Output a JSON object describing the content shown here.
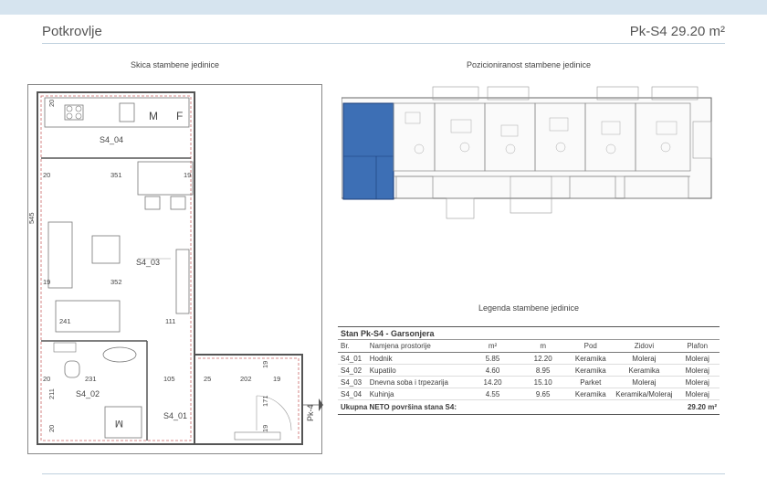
{
  "header": {
    "title": "Potkrovlje",
    "unit": "Pk-S4 29.20 m²"
  },
  "sections": {
    "sketch": "Skica stambene jedinice",
    "position": "Pozicioniranost stambene jedinice",
    "legend": "Legenda stambene jedinice"
  },
  "plan": {
    "rooms": [
      "S4_04",
      "S4_03",
      "S4_02",
      "S4_01"
    ],
    "dims": [
      "20",
      "351",
      "19",
      "20",
      "545",
      "352",
      "19",
      "241",
      "111",
      "20",
      "231",
      "105",
      "25",
      "202",
      "19",
      "211",
      "20",
      "171",
      "19",
      "19"
    ],
    "marks": {
      "m": "M",
      "f": "F",
      "m2": "M",
      "pk": "Pk-4"
    }
  },
  "table": {
    "title": "Stan Pk-S4 - Garsonjera",
    "headers": [
      "Br.",
      "Namjena prostorije",
      "m²",
      "m",
      "Pod",
      "Zidovi",
      "Plafon"
    ],
    "rows": [
      [
        "S4_01",
        "Hodnik",
        "5.85",
        "12.20",
        "Keramika",
        "Moleraj",
        "Moleraj"
      ],
      [
        "S4_02",
        "Kupatilo",
        "4.60",
        "8.95",
        "Keramika",
        "Keramika",
        "Moleraj"
      ],
      [
        "S4_03",
        "Dnevna soba i trpezarija",
        "14.20",
        "15.10",
        "Parket",
        "Moleraj",
        "Moleraj"
      ],
      [
        "S4_04",
        "Kuhinja",
        "4.55",
        "9.65",
        "Keramika",
        "Keramika/Moleraj",
        "Moleraj"
      ]
    ],
    "total_label": "Ukupna NETO površina stana S4:",
    "total_value": "29.20 m²"
  }
}
